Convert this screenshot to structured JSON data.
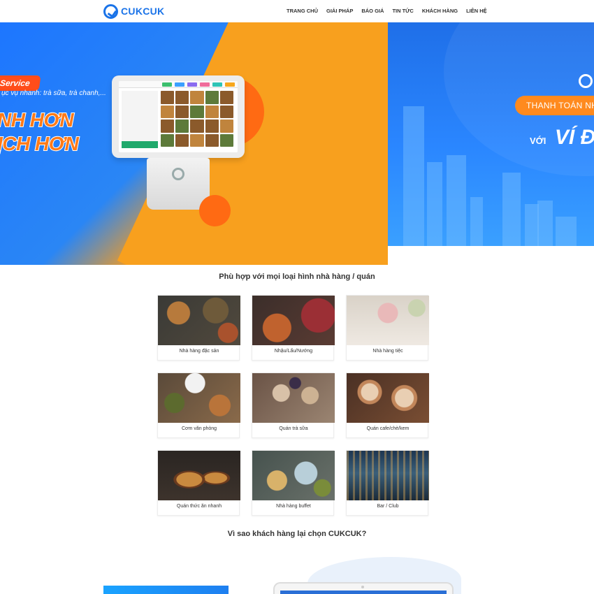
{
  "header": {
    "logo_text": "CUKCUK",
    "nav": [
      "TRANG CHỦ",
      "GIẢI PHÁP",
      "BÁO GIÁ",
      "TIN TỨC",
      "KHÁCH HÀNG",
      "LIÊN HỆ"
    ]
  },
  "banner_left": {
    "tag": "Service",
    "subtitle": "ục vụ nhanh: trà sữa, trà chanh,...",
    "headline_1": "NH HƠN",
    "headline_2": "ỊCH HƠN"
  },
  "banner_right": {
    "pill": "THANH TOÁN NHA",
    "with": "VỚI",
    "wallet": "VÍ Đ"
  },
  "section_types": {
    "title": "Phù hợp với mọi loại hình nhà hàng / quán",
    "cards": [
      {
        "label": "Nhà hàng đặc sản"
      },
      {
        "label": "Nhậu/Lẩu/Nướng"
      },
      {
        "label": "Nhà hàng tiệc"
      },
      {
        "label": "Cơm văn phòng"
      },
      {
        "label": "Quán trà sữa"
      },
      {
        "label": "Quán cafe/chè/kem"
      },
      {
        "label": "Quán thức ăn nhanh"
      },
      {
        "label": "Nhà hàng buffet"
      },
      {
        "label": "Bar / Club"
      }
    ]
  },
  "section_why": {
    "title": "Vì sao khách hàng lại chọn CUKCUK?"
  },
  "colors": {
    "brand": "#1a73e8",
    "orange": "#f8a01e",
    "accent_red": "#ff4d1a"
  }
}
